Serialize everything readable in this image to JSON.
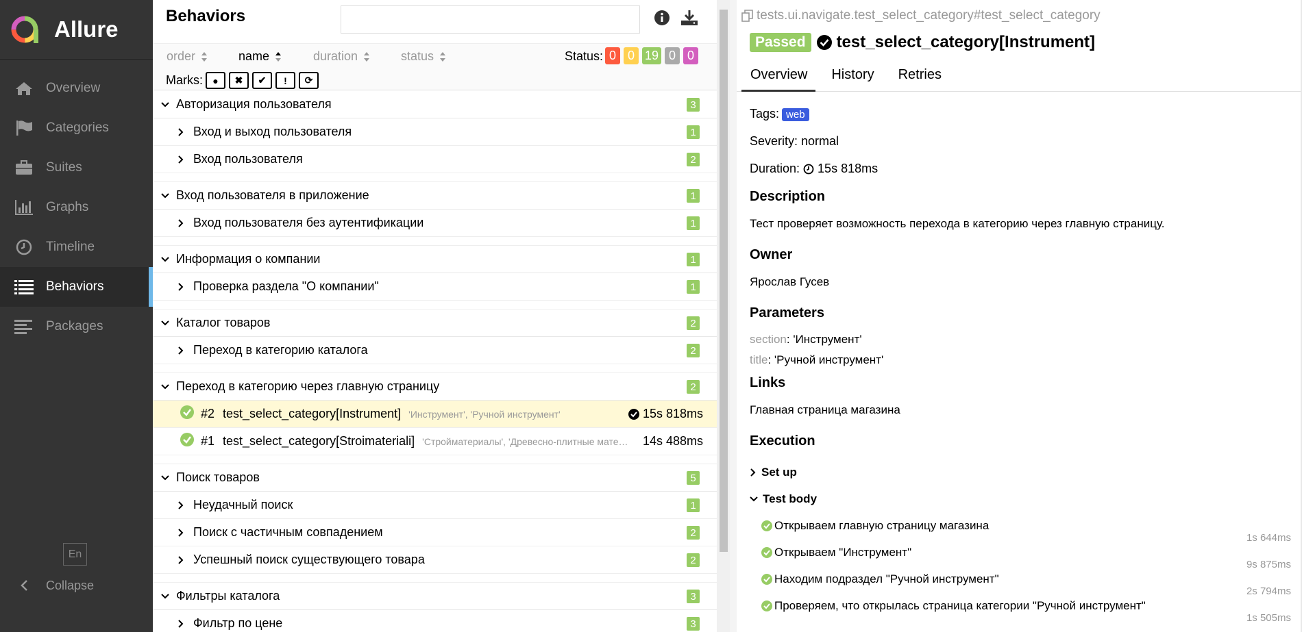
{
  "app": {
    "name": "Allure"
  },
  "sidebar": {
    "items": [
      {
        "label": "Overview",
        "icon": "home-icon"
      },
      {
        "label": "Categories",
        "icon": "flag-icon"
      },
      {
        "label": "Suites",
        "icon": "briefcase-icon"
      },
      {
        "label": "Graphs",
        "icon": "bar-chart-icon"
      },
      {
        "label": "Timeline",
        "icon": "clock-icon"
      },
      {
        "label": "Behaviors",
        "icon": "list-icon",
        "active": true
      },
      {
        "label": "Packages",
        "icon": "align-left-icon"
      }
    ],
    "language": "En",
    "collapse_label": "Collapse"
  },
  "tree": {
    "title": "Behaviors",
    "search_placeholder": "",
    "sort": {
      "order": "order",
      "name": "name",
      "duration": "duration",
      "status": "status"
    },
    "status_label": "Status:",
    "status_counts": [
      {
        "value": "0",
        "color": "#fd5a3e"
      },
      {
        "value": "0",
        "color": "#ffd050"
      },
      {
        "value": "19",
        "color": "#97cc64"
      },
      {
        "value": "0",
        "color": "#aaaaaa"
      },
      {
        "value": "0",
        "color": "#d35ebe"
      }
    ],
    "marks_label": "Marks:",
    "groups": [
      {
        "name": "Авторизация пользователя",
        "count": "3",
        "children": [
          {
            "name": "Вход и выход пользователя",
            "count": "1"
          },
          {
            "name": "Вход пользователя",
            "count": "2"
          }
        ]
      },
      {
        "name": "Вход пользователя в приложение",
        "count": "1",
        "children": [
          {
            "name": "Вход пользователя без аутентификации",
            "count": "1"
          }
        ]
      },
      {
        "name": "Информация о компании",
        "count": "1",
        "children": [
          {
            "name": "Проверка раздела \"О компании\"",
            "count": "1"
          }
        ]
      },
      {
        "name": "Каталог товаров",
        "count": "2",
        "children": [
          {
            "name": "Переход в категорию каталога",
            "count": "2"
          }
        ]
      },
      {
        "name": "Переход в категорию через главную страницу",
        "count": "2",
        "tests": [
          {
            "num": "#2",
            "name": "test_select_category[Instrument]",
            "params": "'Инструмент', 'Ручной инструмент'",
            "duration": "15s 818ms"
          },
          {
            "num": "#1",
            "name": "test_select_category[Stroimateriali]",
            "params": "'Стройматериалы', 'Древесно-плитные мате…",
            "duration": "14s 488ms"
          }
        ]
      },
      {
        "name": "Поиск товаров",
        "count": "5",
        "children": [
          {
            "name": "Неудачный поиск",
            "count": "1"
          },
          {
            "name": "Поиск с частичным совпадением",
            "count": "2"
          },
          {
            "name": "Успешный поиск существующего товара",
            "count": "2"
          }
        ]
      },
      {
        "name": "Фильтры каталога",
        "count": "3",
        "children": [
          {
            "name": "Фильтр по цене",
            "count": "3"
          }
        ]
      }
    ]
  },
  "details": {
    "path": "tests.ui.navigate.test_select_category#test_select_category",
    "status": "Passed",
    "name": "test_select_category[Instrument]",
    "tabs": [
      "Overview",
      "History",
      "Retries"
    ],
    "tags_label": "Tags:",
    "tag": "web",
    "severity": "Severity: normal",
    "duration_label": "Duration:",
    "duration": "15s 818ms",
    "description_title": "Description",
    "description": "Тест проверяет возможность перехода в категорию через главную страницу.",
    "owner_title": "Owner",
    "owner": "Ярослав Гусев",
    "parameters_title": "Parameters",
    "params": [
      {
        "key": "section",
        "value": ": 'Инструмент'"
      },
      {
        "key": "title",
        "value": ": 'Ручной инструмент'"
      }
    ],
    "links_title": "Links",
    "link": "Главная страница магазина",
    "execution_title": "Execution",
    "setup": "Set up",
    "test_body": "Test body",
    "steps": [
      {
        "name": "Открываем главную страницу магазина",
        "duration": "1s 644ms"
      },
      {
        "name": "Открываем \"Инструмент\"",
        "duration": "9s 875ms"
      },
      {
        "name": "Находим подраздел \"Ручной инструмент\"",
        "duration": "2s 794ms"
      },
      {
        "name": "Проверяем, что открылась страница категории \"Ручной инструмент\"",
        "duration": "1s 505ms"
      }
    ]
  }
}
